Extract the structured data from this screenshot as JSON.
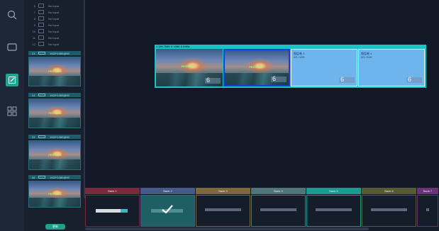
{
  "inputs": [
    {
      "num": "6",
      "label": "No Input"
    },
    {
      "num": "7",
      "label": "No Input"
    },
    {
      "num": "8",
      "label": "No Input"
    },
    {
      "num": "9",
      "label": "No Input"
    },
    {
      "num": "10",
      "label": "No Input"
    },
    {
      "num": "11",
      "label": "No Input"
    },
    {
      "num": "12",
      "label": "No Input"
    }
  ],
  "sources": [
    {
      "num": "13",
      "label": "1920*1080@60"
    },
    {
      "num": "14",
      "label": "1920*1080@60"
    },
    {
      "num": "15",
      "label": "1920*1080@60"
    },
    {
      "num": "16",
      "label": "1920*1080@60"
    }
  ],
  "source_logo": "FESTIVAL",
  "source_button": "更新",
  "screen": {
    "title": "1  UM 7680 X 1080 X 60Hz",
    "windows": [
      {
        "kind": "image",
        "number": "6"
      },
      {
        "kind": "image",
        "number": "6",
        "selected": true
      },
      {
        "kind": "empty",
        "label": "图层卷 3",
        "sub": "0G: 0/20",
        "number": "6"
      },
      {
        "kind": "empty",
        "label": "图层卷 4",
        "sub": "0G: 0/20",
        "number": "6"
      }
    ]
  },
  "banks": [
    {
      "label": "Bank 1",
      "color": "#7a2a3c"
    },
    {
      "label": "Bank 2",
      "color": "#445a8a",
      "active": true
    },
    {
      "label": "Bank 3",
      "color": "#7c6838"
    },
    {
      "label": "Bank 4",
      "color": "#4f7479"
    },
    {
      "label": "Bank 5",
      "color": "#1b9a90"
    },
    {
      "label": "Bank 6",
      "color": "#575b34"
    },
    {
      "label": "Bank 7",
      "color": "#6a3378"
    }
  ],
  "colors": {
    "accent": "#1cc2c4",
    "selected": "#1a3dd8"
  },
  "icons": [
    "search-icon",
    "window-icon",
    "edit-icon",
    "grid-icon",
    "checkmark-icon"
  ]
}
